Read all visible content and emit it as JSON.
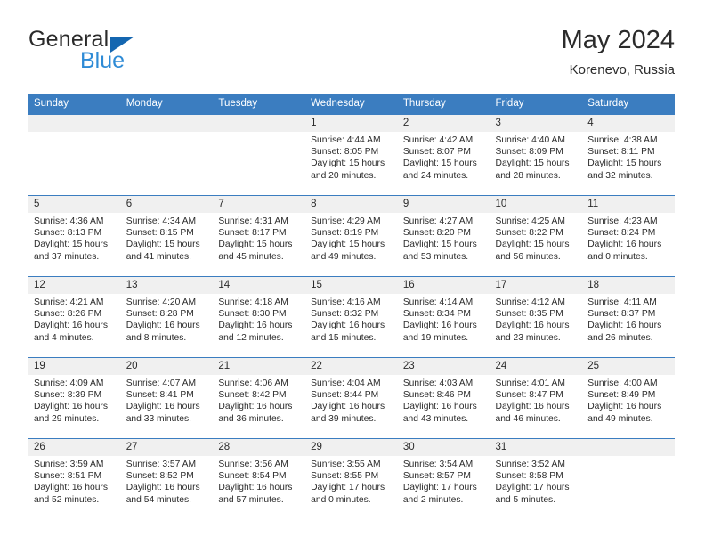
{
  "brand": {
    "word_one": "General",
    "word_two": "Blue",
    "triangle_icon": "triangle-icon",
    "accent_dark": "#1466b0",
    "accent_light": "#2e8bd6"
  },
  "header": {
    "title": "May 2024",
    "location": "Korenevo, Russia",
    "header_bg": "#3b7dc0",
    "daynum_bg": "#f0f0f0"
  },
  "weekday_headers": [
    "Sunday",
    "Monday",
    "Tuesday",
    "Wednesday",
    "Thursday",
    "Friday",
    "Saturday"
  ],
  "weeks": [
    [
      {
        "day": "",
        "sunrise": "",
        "sunset": "",
        "daylight_line1": "",
        "daylight_line2": ""
      },
      {
        "day": "",
        "sunrise": "",
        "sunset": "",
        "daylight_line1": "",
        "daylight_line2": ""
      },
      {
        "day": "",
        "sunrise": "",
        "sunset": "",
        "daylight_line1": "",
        "daylight_line2": ""
      },
      {
        "day": "1",
        "sunrise": "Sunrise: 4:44 AM",
        "sunset": "Sunset: 8:05 PM",
        "daylight_line1": "Daylight: 15 hours",
        "daylight_line2": "and 20 minutes."
      },
      {
        "day": "2",
        "sunrise": "Sunrise: 4:42 AM",
        "sunset": "Sunset: 8:07 PM",
        "daylight_line1": "Daylight: 15 hours",
        "daylight_line2": "and 24 minutes."
      },
      {
        "day": "3",
        "sunrise": "Sunrise: 4:40 AM",
        "sunset": "Sunset: 8:09 PM",
        "daylight_line1": "Daylight: 15 hours",
        "daylight_line2": "and 28 minutes."
      },
      {
        "day": "4",
        "sunrise": "Sunrise: 4:38 AM",
        "sunset": "Sunset: 8:11 PM",
        "daylight_line1": "Daylight: 15 hours",
        "daylight_line2": "and 32 minutes."
      }
    ],
    [
      {
        "day": "5",
        "sunrise": "Sunrise: 4:36 AM",
        "sunset": "Sunset: 8:13 PM",
        "daylight_line1": "Daylight: 15 hours",
        "daylight_line2": "and 37 minutes."
      },
      {
        "day": "6",
        "sunrise": "Sunrise: 4:34 AM",
        "sunset": "Sunset: 8:15 PM",
        "daylight_line1": "Daylight: 15 hours",
        "daylight_line2": "and 41 minutes."
      },
      {
        "day": "7",
        "sunrise": "Sunrise: 4:31 AM",
        "sunset": "Sunset: 8:17 PM",
        "daylight_line1": "Daylight: 15 hours",
        "daylight_line2": "and 45 minutes."
      },
      {
        "day": "8",
        "sunrise": "Sunrise: 4:29 AM",
        "sunset": "Sunset: 8:19 PM",
        "daylight_line1": "Daylight: 15 hours",
        "daylight_line2": "and 49 minutes."
      },
      {
        "day": "9",
        "sunrise": "Sunrise: 4:27 AM",
        "sunset": "Sunset: 8:20 PM",
        "daylight_line1": "Daylight: 15 hours",
        "daylight_line2": "and 53 minutes."
      },
      {
        "day": "10",
        "sunrise": "Sunrise: 4:25 AM",
        "sunset": "Sunset: 8:22 PM",
        "daylight_line1": "Daylight: 15 hours",
        "daylight_line2": "and 56 minutes."
      },
      {
        "day": "11",
        "sunrise": "Sunrise: 4:23 AM",
        "sunset": "Sunset: 8:24 PM",
        "daylight_line1": "Daylight: 16 hours",
        "daylight_line2": "and 0 minutes."
      }
    ],
    [
      {
        "day": "12",
        "sunrise": "Sunrise: 4:21 AM",
        "sunset": "Sunset: 8:26 PM",
        "daylight_line1": "Daylight: 16 hours",
        "daylight_line2": "and 4 minutes."
      },
      {
        "day": "13",
        "sunrise": "Sunrise: 4:20 AM",
        "sunset": "Sunset: 8:28 PM",
        "daylight_line1": "Daylight: 16 hours",
        "daylight_line2": "and 8 minutes."
      },
      {
        "day": "14",
        "sunrise": "Sunrise: 4:18 AM",
        "sunset": "Sunset: 8:30 PM",
        "daylight_line1": "Daylight: 16 hours",
        "daylight_line2": "and 12 minutes."
      },
      {
        "day": "15",
        "sunrise": "Sunrise: 4:16 AM",
        "sunset": "Sunset: 8:32 PM",
        "daylight_line1": "Daylight: 16 hours",
        "daylight_line2": "and 15 minutes."
      },
      {
        "day": "16",
        "sunrise": "Sunrise: 4:14 AM",
        "sunset": "Sunset: 8:34 PM",
        "daylight_line1": "Daylight: 16 hours",
        "daylight_line2": "and 19 minutes."
      },
      {
        "day": "17",
        "sunrise": "Sunrise: 4:12 AM",
        "sunset": "Sunset: 8:35 PM",
        "daylight_line1": "Daylight: 16 hours",
        "daylight_line2": "and 23 minutes."
      },
      {
        "day": "18",
        "sunrise": "Sunrise: 4:11 AM",
        "sunset": "Sunset: 8:37 PM",
        "daylight_line1": "Daylight: 16 hours",
        "daylight_line2": "and 26 minutes."
      }
    ],
    [
      {
        "day": "19",
        "sunrise": "Sunrise: 4:09 AM",
        "sunset": "Sunset: 8:39 PM",
        "daylight_line1": "Daylight: 16 hours",
        "daylight_line2": "and 29 minutes."
      },
      {
        "day": "20",
        "sunrise": "Sunrise: 4:07 AM",
        "sunset": "Sunset: 8:41 PM",
        "daylight_line1": "Daylight: 16 hours",
        "daylight_line2": "and 33 minutes."
      },
      {
        "day": "21",
        "sunrise": "Sunrise: 4:06 AM",
        "sunset": "Sunset: 8:42 PM",
        "daylight_line1": "Daylight: 16 hours",
        "daylight_line2": "and 36 minutes."
      },
      {
        "day": "22",
        "sunrise": "Sunrise: 4:04 AM",
        "sunset": "Sunset: 8:44 PM",
        "daylight_line1": "Daylight: 16 hours",
        "daylight_line2": "and 39 minutes."
      },
      {
        "day": "23",
        "sunrise": "Sunrise: 4:03 AM",
        "sunset": "Sunset: 8:46 PM",
        "daylight_line1": "Daylight: 16 hours",
        "daylight_line2": "and 43 minutes."
      },
      {
        "day": "24",
        "sunrise": "Sunrise: 4:01 AM",
        "sunset": "Sunset: 8:47 PM",
        "daylight_line1": "Daylight: 16 hours",
        "daylight_line2": "and 46 minutes."
      },
      {
        "day": "25",
        "sunrise": "Sunrise: 4:00 AM",
        "sunset": "Sunset: 8:49 PM",
        "daylight_line1": "Daylight: 16 hours",
        "daylight_line2": "and 49 minutes."
      }
    ],
    [
      {
        "day": "26",
        "sunrise": "Sunrise: 3:59 AM",
        "sunset": "Sunset: 8:51 PM",
        "daylight_line1": "Daylight: 16 hours",
        "daylight_line2": "and 52 minutes."
      },
      {
        "day": "27",
        "sunrise": "Sunrise: 3:57 AM",
        "sunset": "Sunset: 8:52 PM",
        "daylight_line1": "Daylight: 16 hours",
        "daylight_line2": "and 54 minutes."
      },
      {
        "day": "28",
        "sunrise": "Sunrise: 3:56 AM",
        "sunset": "Sunset: 8:54 PM",
        "daylight_line1": "Daylight: 16 hours",
        "daylight_line2": "and 57 minutes."
      },
      {
        "day": "29",
        "sunrise": "Sunrise: 3:55 AM",
        "sunset": "Sunset: 8:55 PM",
        "daylight_line1": "Daylight: 17 hours",
        "daylight_line2": "and 0 minutes."
      },
      {
        "day": "30",
        "sunrise": "Sunrise: 3:54 AM",
        "sunset": "Sunset: 8:57 PM",
        "daylight_line1": "Daylight: 17 hours",
        "daylight_line2": "and 2 minutes."
      },
      {
        "day": "31",
        "sunrise": "Sunrise: 3:52 AM",
        "sunset": "Sunset: 8:58 PM",
        "daylight_line1": "Daylight: 17 hours",
        "daylight_line2": "and 5 minutes."
      },
      {
        "day": "",
        "sunrise": "",
        "sunset": "",
        "daylight_line1": "",
        "daylight_line2": ""
      }
    ]
  ]
}
